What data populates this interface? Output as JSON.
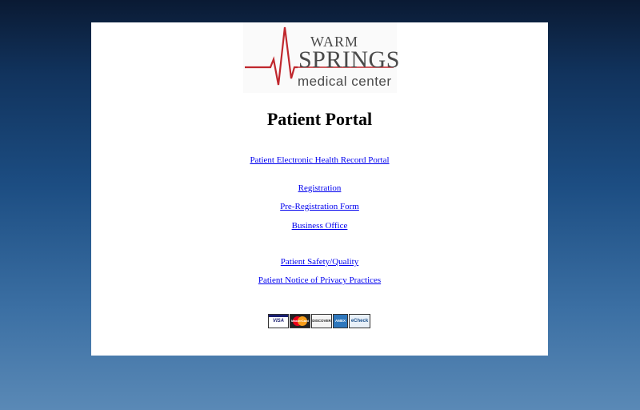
{
  "logo": {
    "line1": "WARM",
    "line2": "SPRINGS",
    "line3": "medical center"
  },
  "page_title": "Patient Portal",
  "links": [
    {
      "label": "Patient Electronic Health Record Portal"
    },
    {
      "label": "Registration"
    },
    {
      "label": "Pre-Registration Form"
    },
    {
      "label": "Business Office"
    },
    {
      "label": "Patient Safety/Quality"
    },
    {
      "label": "Patient Notice of Privacy Practices"
    }
  ],
  "payment_cards": [
    {
      "label": "VISA",
      "icon": "visa-card-icon"
    },
    {
      "label": "MasterCard",
      "icon": "mastercard-card-icon"
    },
    {
      "label": "DISCOVER",
      "icon": "discover-card-icon"
    },
    {
      "label": "AMEX",
      "icon": "amex-card-icon"
    },
    {
      "label": "eCheck",
      "icon": "echeck-card-icon"
    }
  ],
  "colors": {
    "link": "#0000ee",
    "logo_red": "#c0272d",
    "logo_gray": "#4a4a4a"
  }
}
